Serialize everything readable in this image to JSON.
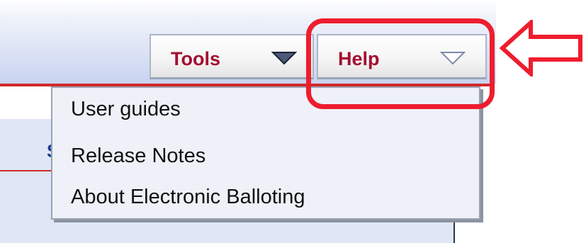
{
  "toolbar": {
    "tools_label": "Tools",
    "help_label": "Help"
  },
  "help_menu": {
    "items": [
      {
        "label": "User guides"
      },
      {
        "label": "Release Notes"
      },
      {
        "label": "About Electronic Balloting"
      }
    ]
  },
  "colors": {
    "button_text": "#a3102f",
    "highlight": "#ee1d2e",
    "header_line": "#d12a2a"
  },
  "icons": {
    "dropdown": "chevron-down-triangle",
    "pointer": "left-arrow-outline"
  }
}
